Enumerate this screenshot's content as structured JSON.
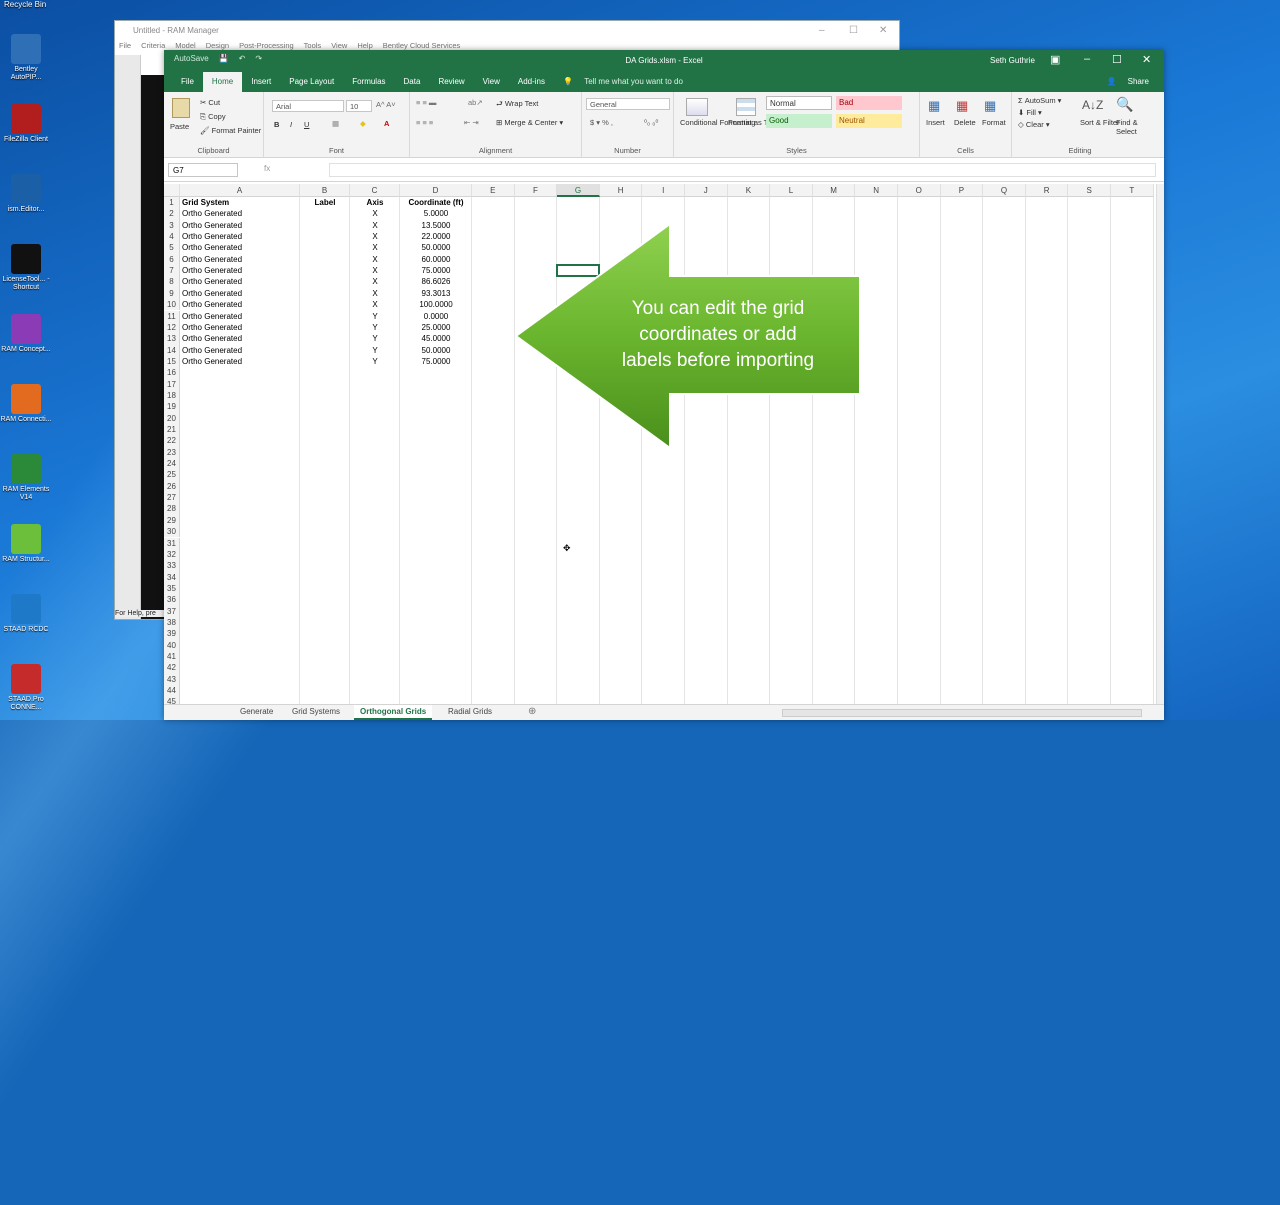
{
  "desktop": {
    "recycle_bin": "Recycle Bin",
    "icons": [
      {
        "label": "Bentley AutoPIP...",
        "icon": "bentley-autopipe-icon",
        "color": "#2f6fb5"
      },
      {
        "label": "FileZilla Client",
        "icon": "filezilla-icon",
        "color": "#b21d1d"
      },
      {
        "label": "ism.Editor...",
        "icon": "ism-editor-icon",
        "color": "#1b5fa6"
      },
      {
        "label": "LicenseTool... - Shortcut",
        "icon": "bentley-b-icon",
        "color": "#111111"
      },
      {
        "label": "RAM Concept...",
        "icon": "ram-concept-icon",
        "color": "#8a3bb5"
      },
      {
        "label": "RAM Connecti...",
        "icon": "ram-connection-icon",
        "color": "#e36b1f"
      },
      {
        "label": "RAM Elements V14",
        "icon": "ram-elements-icon",
        "color": "#2a8a3a"
      },
      {
        "label": "RAM Structur...",
        "icon": "ram-structural-icon",
        "color": "#6bbf3a"
      },
      {
        "label": "STAAD RCDC",
        "icon": "staad-rcdc-icon",
        "color": "#1e7ac9"
      },
      {
        "label": "STAAD.Pro CONNE...",
        "icon": "staad-pro-icon",
        "color": "#c62b2b"
      }
    ]
  },
  "ram_window": {
    "title": "Untitled - RAM Manager",
    "menu": [
      "File",
      "Criteria",
      "Model",
      "Design",
      "Post-Processing",
      "Tools",
      "View",
      "Help",
      "Bentley Cloud Services"
    ],
    "status": "For Help, pre"
  },
  "excel": {
    "title": "DA Grids.xlsm - Excel",
    "user": "Seth Guthrie",
    "autosave": "AutoSave",
    "tabs": [
      "File",
      "Home",
      "Insert",
      "Page Layout",
      "Formulas",
      "Data",
      "Review",
      "View",
      "Add-ins"
    ],
    "active_tab": "Home",
    "tell_me": "Tell me what you want to do",
    "share": "Share",
    "ribbon": {
      "clipboard": {
        "label": "Clipboard",
        "paste": "Paste",
        "cut": "Cut",
        "copy": "Copy",
        "format_painter": "Format Painter"
      },
      "font": {
        "label": "Font",
        "name": "Arial",
        "size": "10",
        "bold": "B",
        "italic": "I",
        "underline": "U"
      },
      "alignment": {
        "label": "Alignment",
        "wrap": "Wrap Text",
        "merge": "Merge & Center"
      },
      "number": {
        "label": "Number",
        "format": "General"
      },
      "styles": {
        "label": "Styles",
        "cond": "Conditional Formatting",
        "table": "Format as Table",
        "normal": "Normal",
        "bad": "Bad",
        "good": "Good",
        "neutral": "Neutral"
      },
      "cells": {
        "label": "Cells",
        "insert": "Insert",
        "delete": "Delete",
        "format": "Format"
      },
      "editing": {
        "label": "Editing",
        "autosum": "AutoSum",
        "fill": "Fill",
        "clear": "Clear",
        "sort": "Sort & Filter",
        "find": "Find & Select"
      }
    },
    "name_box": "G7",
    "fx": "fx",
    "columns": [
      "A",
      "B",
      "C",
      "D",
      "E",
      "F",
      "G",
      "H",
      "I",
      "J",
      "K",
      "L",
      "M",
      "N",
      "O",
      "P",
      "Q",
      "R",
      "S",
      "T"
    ],
    "selected_column": "G",
    "headers": {
      "a": "Grid System",
      "b": "Label",
      "c": "Axis",
      "d": "Coordinate (ft)"
    },
    "rows": [
      {
        "a": "Ortho Generated",
        "c": "X",
        "d": "5.0000"
      },
      {
        "a": "Ortho Generated",
        "c": "X",
        "d": "13.5000"
      },
      {
        "a": "Ortho Generated",
        "c": "X",
        "d": "22.0000"
      },
      {
        "a": "Ortho Generated",
        "c": "X",
        "d": "50.0000"
      },
      {
        "a": "Ortho Generated",
        "c": "X",
        "d": "60.0000"
      },
      {
        "a": "Ortho Generated",
        "c": "X",
        "d": "75.0000"
      },
      {
        "a": "Ortho Generated",
        "c": "X",
        "d": "86.6026"
      },
      {
        "a": "Ortho Generated",
        "c": "X",
        "d": "93.3013"
      },
      {
        "a": "Ortho Generated",
        "c": "X",
        "d": "100.0000"
      },
      {
        "a": "Ortho Generated",
        "c": "Y",
        "d": "0.0000"
      },
      {
        "a": "Ortho Generated",
        "c": "Y",
        "d": "25.0000"
      },
      {
        "a": "Ortho Generated",
        "c": "Y",
        "d": "45.0000"
      },
      {
        "a": "Ortho Generated",
        "c": "Y",
        "d": "50.0000"
      },
      {
        "a": "Ortho Generated",
        "c": "Y",
        "d": "75.0000"
      }
    ],
    "row_count": 45,
    "sheet_tabs": [
      "Generate",
      "Grid Systems",
      "Orthogonal Grids",
      "Radial Grids"
    ],
    "active_sheet": "Orthogonal Grids"
  },
  "callout": {
    "lines": [
      "You can edit the grid",
      "coordinates or add",
      "labels before importing"
    ],
    "color": "#6ab52e"
  }
}
